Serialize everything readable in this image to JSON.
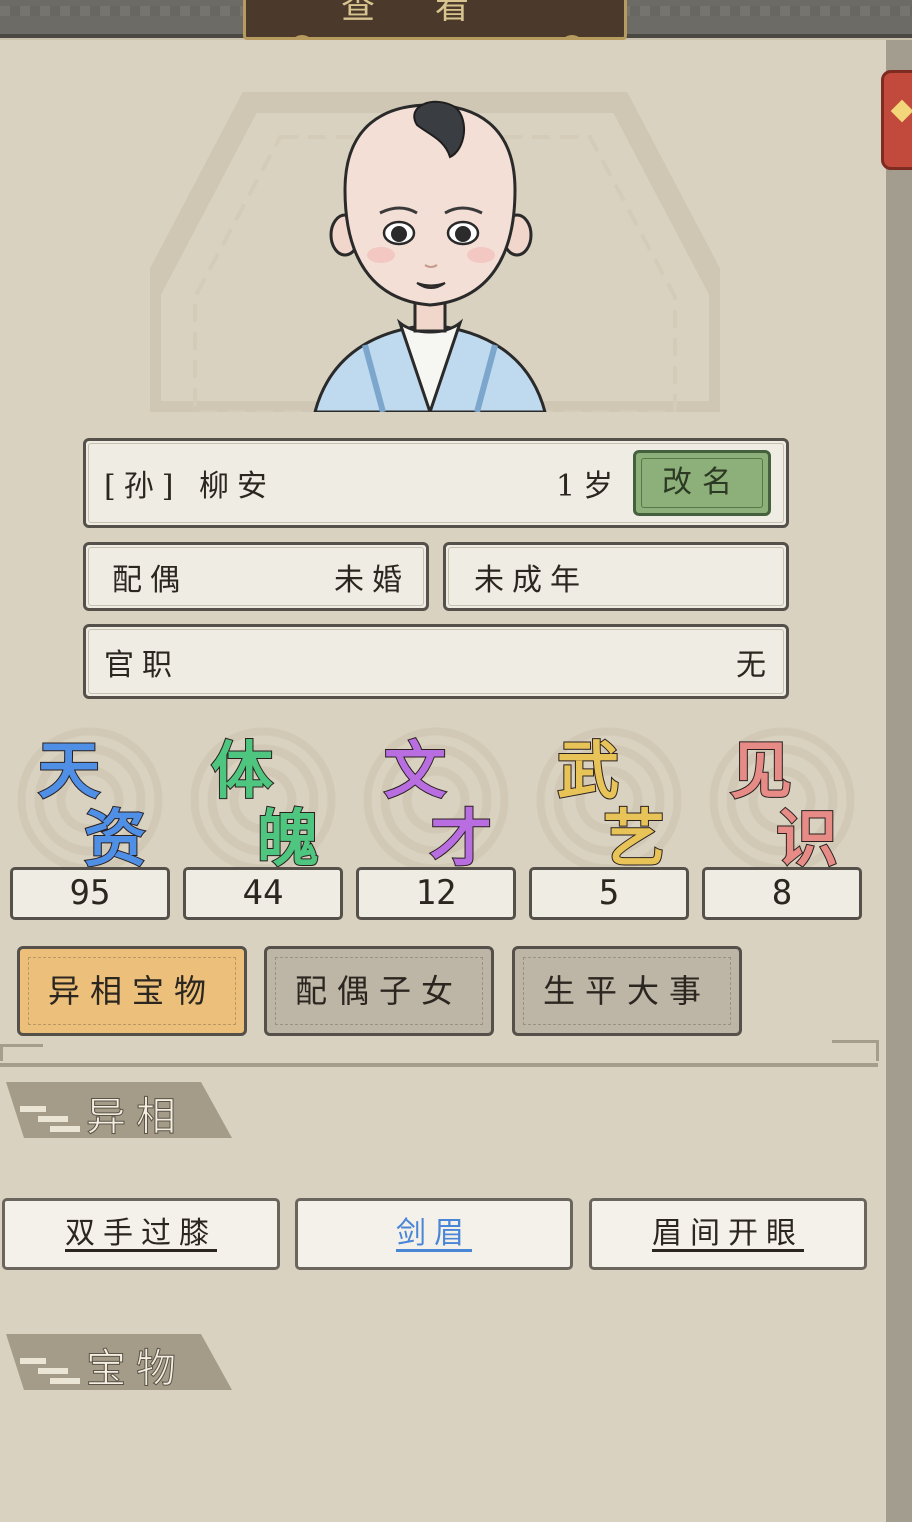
{
  "header": {
    "title": "查看"
  },
  "profile": {
    "name": "[孙] 柳安",
    "age": "1岁",
    "rename_label": "改名",
    "spouse_label": "配偶",
    "spouse_value": "未婚",
    "adult_status": "未成年",
    "office_label": "官职",
    "office_value": "无"
  },
  "stats": [
    {
      "c1": "天",
      "c2": "资",
      "value": "95",
      "color": "#4f8fe6"
    },
    {
      "c1": "体",
      "c2": "魄",
      "value": "44",
      "color": "#4fc67f"
    },
    {
      "c1": "文",
      "c2": "才",
      "value": "12",
      "color": "#b86ee0"
    },
    {
      "c1": "武",
      "c2": "艺",
      "value": "5",
      "color": "#e8c458"
    },
    {
      "c1": "见",
      "c2": "识",
      "value": "8",
      "color": "#e68b86"
    }
  ],
  "tabs": [
    {
      "label": "异相宝物",
      "active": true
    },
    {
      "label": "配偶子女",
      "active": false
    },
    {
      "label": "生平大事",
      "active": false
    }
  ],
  "sections": {
    "traits_title": "异相",
    "treasures_title": "宝物"
  },
  "traits": [
    {
      "label": "双手过膝",
      "color": "#2b2620"
    },
    {
      "label": "剑眉",
      "color": "#4a86d6"
    },
    {
      "label": "眉间开眼",
      "color": "#2b2620"
    }
  ]
}
